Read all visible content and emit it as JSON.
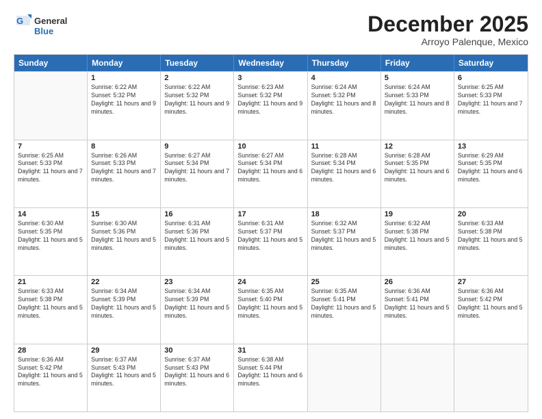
{
  "logo": {
    "general": "General",
    "blue": "Blue"
  },
  "title": "December 2025",
  "location": "Arroyo Palenque, Mexico",
  "weekdays": [
    "Sunday",
    "Monday",
    "Tuesday",
    "Wednesday",
    "Thursday",
    "Friday",
    "Saturday"
  ],
  "weeks": [
    [
      {
        "day": "",
        "sunrise": "",
        "sunset": "",
        "daylight": ""
      },
      {
        "day": "1",
        "sunrise": "Sunrise: 6:22 AM",
        "sunset": "Sunset: 5:32 PM",
        "daylight": "Daylight: 11 hours and 9 minutes."
      },
      {
        "day": "2",
        "sunrise": "Sunrise: 6:22 AM",
        "sunset": "Sunset: 5:32 PM",
        "daylight": "Daylight: 11 hours and 9 minutes."
      },
      {
        "day": "3",
        "sunrise": "Sunrise: 6:23 AM",
        "sunset": "Sunset: 5:32 PM",
        "daylight": "Daylight: 11 hours and 9 minutes."
      },
      {
        "day": "4",
        "sunrise": "Sunrise: 6:24 AM",
        "sunset": "Sunset: 5:32 PM",
        "daylight": "Daylight: 11 hours and 8 minutes."
      },
      {
        "day": "5",
        "sunrise": "Sunrise: 6:24 AM",
        "sunset": "Sunset: 5:33 PM",
        "daylight": "Daylight: 11 hours and 8 minutes."
      },
      {
        "day": "6",
        "sunrise": "Sunrise: 6:25 AM",
        "sunset": "Sunset: 5:33 PM",
        "daylight": "Daylight: 11 hours and 7 minutes."
      }
    ],
    [
      {
        "day": "7",
        "sunrise": "Sunrise: 6:25 AM",
        "sunset": "Sunset: 5:33 PM",
        "daylight": "Daylight: 11 hours and 7 minutes."
      },
      {
        "day": "8",
        "sunrise": "Sunrise: 6:26 AM",
        "sunset": "Sunset: 5:33 PM",
        "daylight": "Daylight: 11 hours and 7 minutes."
      },
      {
        "day": "9",
        "sunrise": "Sunrise: 6:27 AM",
        "sunset": "Sunset: 5:34 PM",
        "daylight": "Daylight: 11 hours and 7 minutes."
      },
      {
        "day": "10",
        "sunrise": "Sunrise: 6:27 AM",
        "sunset": "Sunset: 5:34 PM",
        "daylight": "Daylight: 11 hours and 6 minutes."
      },
      {
        "day": "11",
        "sunrise": "Sunrise: 6:28 AM",
        "sunset": "Sunset: 5:34 PM",
        "daylight": "Daylight: 11 hours and 6 minutes."
      },
      {
        "day": "12",
        "sunrise": "Sunrise: 6:28 AM",
        "sunset": "Sunset: 5:35 PM",
        "daylight": "Daylight: 11 hours and 6 minutes."
      },
      {
        "day": "13",
        "sunrise": "Sunrise: 6:29 AM",
        "sunset": "Sunset: 5:35 PM",
        "daylight": "Daylight: 11 hours and 6 minutes."
      }
    ],
    [
      {
        "day": "14",
        "sunrise": "Sunrise: 6:30 AM",
        "sunset": "Sunset: 5:35 PM",
        "daylight": "Daylight: 11 hours and 5 minutes."
      },
      {
        "day": "15",
        "sunrise": "Sunrise: 6:30 AM",
        "sunset": "Sunset: 5:36 PM",
        "daylight": "Daylight: 11 hours and 5 minutes."
      },
      {
        "day": "16",
        "sunrise": "Sunrise: 6:31 AM",
        "sunset": "Sunset: 5:36 PM",
        "daylight": "Daylight: 11 hours and 5 minutes."
      },
      {
        "day": "17",
        "sunrise": "Sunrise: 6:31 AM",
        "sunset": "Sunset: 5:37 PM",
        "daylight": "Daylight: 11 hours and 5 minutes."
      },
      {
        "day": "18",
        "sunrise": "Sunrise: 6:32 AM",
        "sunset": "Sunset: 5:37 PM",
        "daylight": "Daylight: 11 hours and 5 minutes."
      },
      {
        "day": "19",
        "sunrise": "Sunrise: 6:32 AM",
        "sunset": "Sunset: 5:38 PM",
        "daylight": "Daylight: 11 hours and 5 minutes."
      },
      {
        "day": "20",
        "sunrise": "Sunrise: 6:33 AM",
        "sunset": "Sunset: 5:38 PM",
        "daylight": "Daylight: 11 hours and 5 minutes."
      }
    ],
    [
      {
        "day": "21",
        "sunrise": "Sunrise: 6:33 AM",
        "sunset": "Sunset: 5:38 PM",
        "daylight": "Daylight: 11 hours and 5 minutes."
      },
      {
        "day": "22",
        "sunrise": "Sunrise: 6:34 AM",
        "sunset": "Sunset: 5:39 PM",
        "daylight": "Daylight: 11 hours and 5 minutes."
      },
      {
        "day": "23",
        "sunrise": "Sunrise: 6:34 AM",
        "sunset": "Sunset: 5:39 PM",
        "daylight": "Daylight: 11 hours and 5 minutes."
      },
      {
        "day": "24",
        "sunrise": "Sunrise: 6:35 AM",
        "sunset": "Sunset: 5:40 PM",
        "daylight": "Daylight: 11 hours and 5 minutes."
      },
      {
        "day": "25",
        "sunrise": "Sunrise: 6:35 AM",
        "sunset": "Sunset: 5:41 PM",
        "daylight": "Daylight: 11 hours and 5 minutes."
      },
      {
        "day": "26",
        "sunrise": "Sunrise: 6:36 AM",
        "sunset": "Sunset: 5:41 PM",
        "daylight": "Daylight: 11 hours and 5 minutes."
      },
      {
        "day": "27",
        "sunrise": "Sunrise: 6:36 AM",
        "sunset": "Sunset: 5:42 PM",
        "daylight": "Daylight: 11 hours and 5 minutes."
      }
    ],
    [
      {
        "day": "28",
        "sunrise": "Sunrise: 6:36 AM",
        "sunset": "Sunset: 5:42 PM",
        "daylight": "Daylight: 11 hours and 5 minutes."
      },
      {
        "day": "29",
        "sunrise": "Sunrise: 6:37 AM",
        "sunset": "Sunset: 5:43 PM",
        "daylight": "Daylight: 11 hours and 5 minutes."
      },
      {
        "day": "30",
        "sunrise": "Sunrise: 6:37 AM",
        "sunset": "Sunset: 5:43 PM",
        "daylight": "Daylight: 11 hours and 6 minutes."
      },
      {
        "day": "31",
        "sunrise": "Sunrise: 6:38 AM",
        "sunset": "Sunset: 5:44 PM",
        "daylight": "Daylight: 11 hours and 6 minutes."
      },
      {
        "day": "",
        "sunrise": "",
        "sunset": "",
        "daylight": ""
      },
      {
        "day": "",
        "sunrise": "",
        "sunset": "",
        "daylight": ""
      },
      {
        "day": "",
        "sunrise": "",
        "sunset": "",
        "daylight": ""
      }
    ]
  ]
}
